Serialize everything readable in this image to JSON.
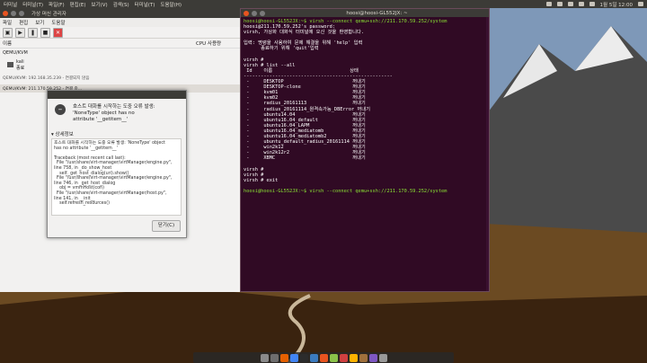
{
  "top_panel": {
    "menu": [
      "터미널",
      "터미널(T)",
      "파일(F)",
      "편집(E)",
      "보기(V)",
      "검색(S)",
      "터미널(T)",
      "도움말(H)"
    ],
    "clock": "1월 5일 12:00",
    "icons": [
      "dropbox-icon",
      "network-icon",
      "keyboard-icon",
      "sound-icon",
      "battery-icon",
      "settings-icon"
    ]
  },
  "vm_window": {
    "title": "가상 머신 관리자",
    "menu": [
      "파일",
      "편집",
      "보기",
      "도움말"
    ],
    "toolbar": [
      "open-icon",
      "run-icon",
      "pause-icon",
      "stop-icon",
      "delete-icon"
    ],
    "headers": {
      "name": "이름",
      "cpu": "CPU 사용량"
    },
    "rows": [
      {
        "type": "group",
        "text": "QEMU/KVM"
      },
      {
        "type": "vm",
        "name": "kali",
        "state": "종료"
      },
      {
        "type": "group",
        "text": "QEMU/KVM: 192.168.35.239 - 연결되지 않음"
      },
      {
        "type": "group-active",
        "text": "QEMU/KVM: 211.170.59.252 - 연결 중..."
      }
    ]
  },
  "error_dialog": {
    "message_1": "호스트 대화를 시작하는 도중 오류 발생:",
    "message_2": "'NoneType' object has no",
    "message_3": "attribute '__getitem__'",
    "details_label": "▾ 상세정보",
    "details_text": "호스트 대화를 시작하는 도중 오류 발생: 'NoneType' object\nhas no attribute '__getitem__'\n\nTraceback (most recent call last):\n  File \"/usr/share/virt-manager/virtManager/engine.py\",\nline 758, in _do_show_host\n    self._get_host_dialog(uri).show()\n  File \"/usr/share/virt-manager/virtManager/engine.py\",\nline 746, in _get_host_dialog\n    obj = vmmHost(con)\n  File \"/usr/share/virt-manager/virtManager/host.py\",\nline 141, in __init__\n    self.refresh_resources()",
    "close_label": "닫기(C)"
  },
  "terminal": {
    "title": "hoosi@hoosi-GL552JX: ~",
    "lines": [
      "hoosi@hoosi-GL552JX:~$ virsh --connect qemu+ssh://211.170.59.252/system",
      "hoosi@211.170.59.252's password:",
      "virsh, 가상화 대화식 터미널에 오신 것을 환영합니다.",
      "",
      "입력: 명령을 사용하여 문제 해결을 위해 'help' 입력",
      "      종료하기 위해 'quit'입력",
      "",
      "virsh # ",
      "virsh # list --all",
      " Id    이름                           상태",
      "----------------------------------------------------",
      " -     DESKTOP                        꺼내기",
      " -     DESKTOP-clone                  꺼내기",
      " -     kvm01                          꺼내기",
      " -     kvm02                          꺼내기",
      " -     radius_20161113                꺼내기",
      " -     radius_20161114_원격속가능_DBError 꺼내기",
      " -     ubuntu14.04                    꺼내기",
      " -     ubuntu16.04_default            꺼내기",
      " -     ubuntu16.04_LAPM               꺼내기",
      " -     ubuntu16.04_mediatomb          꺼내기",
      " -     ubuntu16.04_mediatomb2         꺼내기",
      " -     ubuntu_default_radius_20161114 꺼내기",
      " -     win2k12                        꺼내기",
      " -     win2k12r2                      꺼내기",
      " -     XBMC                           꺼내기",
      "",
      "virsh # ",
      "virsh # ",
      "virsh # exit",
      "",
      "hoosi@hoosi-GL552JX:~$ virsh --connect qemu+ssh://211.170.59.252/system"
    ]
  },
  "dock_items": [
    "files-icon",
    "settings-icon",
    "firefox-icon",
    "chrome-icon",
    "terminal-icon",
    "monitor-icon",
    "music-icon",
    "image-icon",
    "virt-icon",
    "mail-icon",
    "folder-icon",
    "app-icon",
    "trash-icon"
  ],
  "colors": {
    "terminal_bg": "#300a24",
    "panel_bg": "#3c3b37",
    "prompt": "#ffffff"
  }
}
